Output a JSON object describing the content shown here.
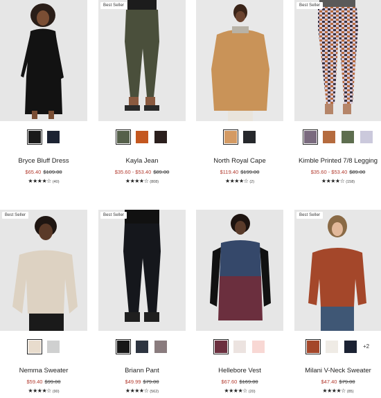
{
  "products": [
    {
      "name": "Bryce Bluff Dress",
      "sale": "$65.40",
      "orig": "$109.00",
      "stars": "★★★★☆",
      "count": "(40)",
      "badge": "",
      "swatches": [
        "#1a1a1a",
        "#1c2333"
      ],
      "more": ""
    },
    {
      "name": "Kayla Jean",
      "sale": "$35.60 - $53.40",
      "orig": "$89.00",
      "stars": "★★★★☆",
      "count": "(808)",
      "badge": "Best Seller",
      "swatches": [
        "#55604a",
        "#c4571f",
        "#2b1f1d"
      ],
      "more": ""
    },
    {
      "name": "North Royal Cape",
      "sale": "$119.40",
      "orig": "$199.00",
      "stars": "★★★★☆",
      "count": "(2)",
      "badge": "",
      "swatches": [
        "#d49a63",
        "#26282c"
      ],
      "more": ""
    },
    {
      "name": "Kimble Printed 7/8 Legging",
      "sale": "$35.60 - $53.40",
      "orig": "$89.00",
      "stars": "★★★★☆",
      "count": "(158)",
      "badge": "Best Seller",
      "swatches": [
        "#7a6a7e",
        "#b56b3e",
        "#5e6e4f",
        "#cbc9dc"
      ],
      "more": ""
    },
    {
      "name": "Nemma Sweater",
      "sale": "$59.40",
      "orig": "$99.00",
      "stars": "★★★★☆",
      "count": "(90)",
      "badge": "Best Seller",
      "swatches": [
        "#e8dccd",
        "#cfd0d0"
      ],
      "more": ""
    },
    {
      "name": "Briann Pant",
      "sale": "$49.99",
      "orig": "$79.00",
      "stars": "★★★★☆",
      "count": "(562)",
      "badge": "Best Seller",
      "swatches": [
        "#171717",
        "#2d3440",
        "#8a7c7e"
      ],
      "more": ""
    },
    {
      "name": "Hellebore Vest",
      "sale": "$67.60",
      "orig": "$169.00",
      "stars": "★★★★☆",
      "count": "(20)",
      "badge": "",
      "swatches": [
        "#6b2f3e",
        "#ece3e0",
        "#f8d8d4"
      ],
      "more": ""
    },
    {
      "name": "Milani V-Neck Sweater",
      "sale": "$47.40",
      "orig": "$79.00",
      "stars": "★★★★☆",
      "count": "(85)",
      "badge": "Best Seller",
      "swatches": [
        "#a4472a",
        "#efebe5",
        "#1b2233"
      ],
      "more": "+2"
    }
  ]
}
